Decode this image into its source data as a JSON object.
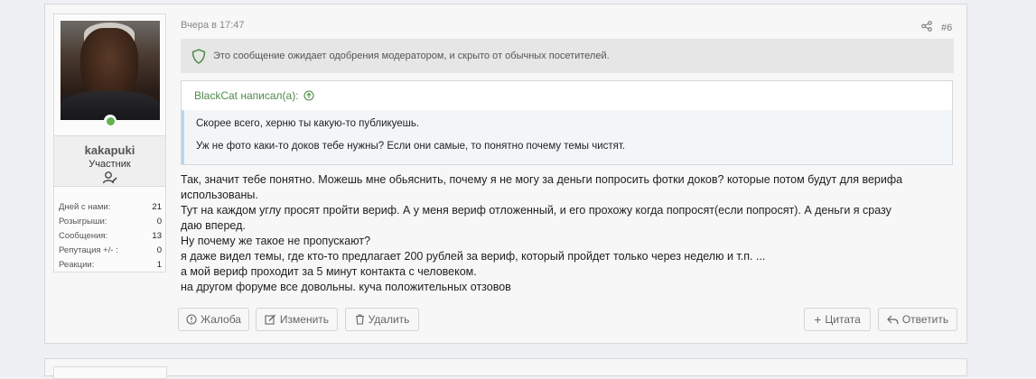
{
  "user": {
    "username": "kakapuki",
    "role": "Участник",
    "stats": [
      {
        "label": "Дней с нами:",
        "value": "21"
      },
      {
        "label": "Розыгрыши:",
        "value": "0"
      },
      {
        "label": "Сообщения:",
        "value": "13"
      },
      {
        "label": "Репутация +/- :",
        "value": "0"
      },
      {
        "label": "Реакции:",
        "value": "1"
      }
    ]
  },
  "post": {
    "time": "Вчера в 17:47",
    "number": "#6",
    "notice": "Это сообщение ожидает одобрения модератором, и скрыто от обычных посетителей.",
    "quote": {
      "author": "BlackCat написал(а):",
      "line1": "Скорее всего, херню ты какую-то публикуешь.",
      "line2": "Уж не фото каки-то доков тебе нужны? Если они самые, то понятно почему темы чистят."
    },
    "message": [
      "Так, значит тебе понятно. Можешь мне обьяснить, почему я не могу за деньги попросить фотки доков? которые потом будут для верифа",
      "использованы.",
      "Тут на каждом углу просят пройти вериф. А у меня вериф отложенный, и его прохожу когда попросят(если попросят). А деньги я сразу",
      "даю вперед.",
      "Ну почему же такое не пропускают?",
      "я даже видел темы, где кто-то предлагает 200 рублей за вериф, который пройдет только через неделю и т.п. ...",
      "а мой вериф проходит за 5 минут контакта с человеком.",
      "на другом форуме все довольны. куча положительных отзовов"
    ],
    "actions": {
      "report": "Жалоба",
      "edit": "Изменить",
      "delete": "Удалить",
      "quote": "Цитата",
      "reply": "Ответить"
    }
  },
  "colors": {
    "accent_green": "#4f8a4a",
    "online": "#63b34c"
  }
}
